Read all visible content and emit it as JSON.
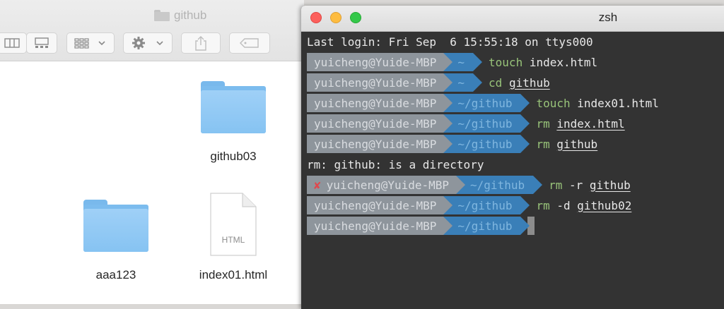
{
  "finder": {
    "title": "github",
    "files": [
      {
        "name": "github03",
        "kind": "folder"
      },
      {
        "name": "aaa123",
        "kind": "folder"
      },
      {
        "name": "index01.html",
        "kind": "html-document",
        "badge": "HTML"
      }
    ],
    "toolbar_icons": [
      "columns-view-icon",
      "gallery-view-icon",
      "group-by-icon",
      "gear-action-icon",
      "share-icon",
      "tag-icon"
    ]
  },
  "terminal": {
    "title": "zsh",
    "last_login": "Last login: Fri Sep  6 15:55:18 on ttys000",
    "prompts": [
      {
        "user": "yuicheng@Yuide-MBP",
        "dir": "~",
        "cmd": "touch",
        "arg": "index.html",
        "arg_underlined": false,
        "error": false
      },
      {
        "user": "yuicheng@Yuide-MBP",
        "dir": "~",
        "cmd": "cd",
        "arg": "github",
        "arg_underlined": true,
        "error": false
      },
      {
        "user": "yuicheng@Yuide-MBP",
        "dir": "~/github",
        "cmd": "touch",
        "arg": "index01.html",
        "arg_underlined": false,
        "error": false
      },
      {
        "user": "yuicheng@Yuide-MBP",
        "dir": "~/github",
        "cmd": "rm",
        "arg": "index.html",
        "arg_underlined": true,
        "error": false
      },
      {
        "user": "yuicheng@Yuide-MBP",
        "dir": "~/github",
        "cmd": "rm",
        "arg": "github",
        "arg_underlined": true,
        "error": false
      }
    ],
    "error_output": "rm: github: is a directory",
    "prompts_after": [
      {
        "user": "yuicheng@Yuide-MBP",
        "dir": "~/github",
        "cmd": "rm",
        "flag": "-r",
        "arg": "github",
        "error": true
      },
      {
        "user": "yuicheng@Yuide-MBP",
        "dir": "~/github",
        "cmd": "rm",
        "flag": "-d",
        "arg": "github02",
        "error": false
      },
      {
        "user": "yuicheng@Yuide-MBP",
        "dir": "~/github",
        "cmd": "",
        "flag": "",
        "arg": "",
        "error": false
      }
    ],
    "error_mark": "✘",
    "colors": {
      "user_segment": "#8e959c",
      "dir_segment": "#3a7fb8",
      "command": "#98c379",
      "error_mark": "#e0484e",
      "background": "#333333"
    }
  }
}
